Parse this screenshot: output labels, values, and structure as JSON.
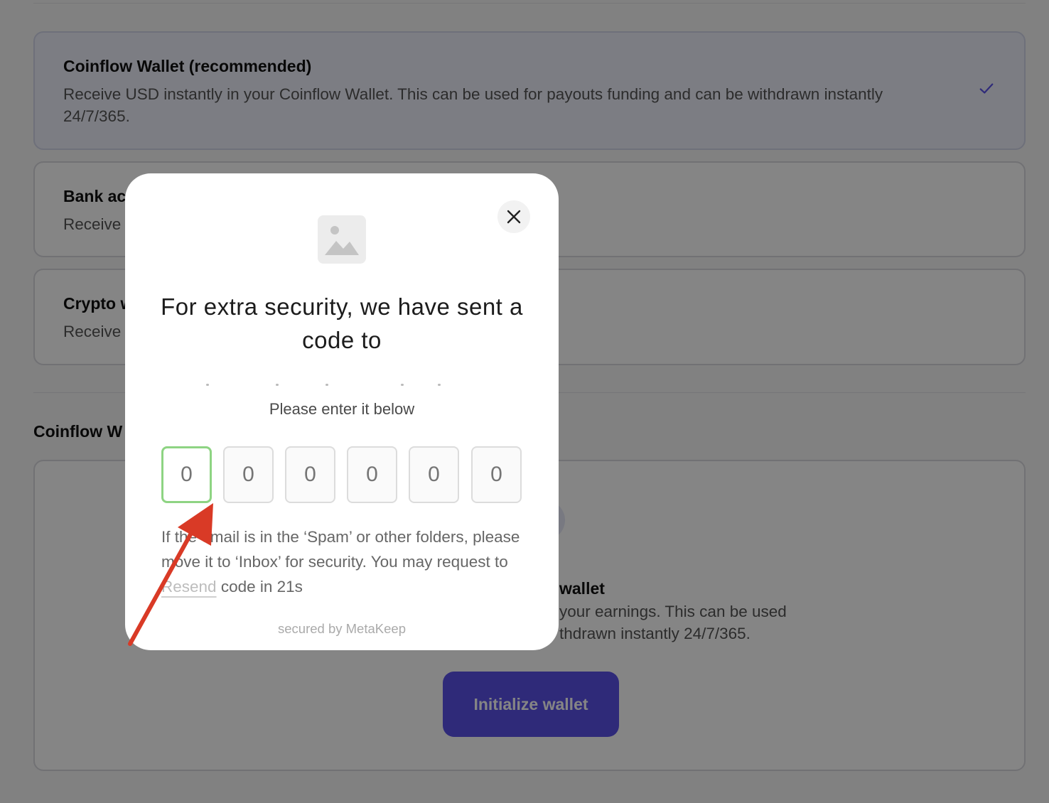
{
  "background": {
    "options": [
      {
        "title": "Coinflow Wallet (recommended)",
        "description": "Receive USD instantly in your Coinflow Wallet. This can be used for payouts funding and can be withdrawn instantly 24/7/365.",
        "selected": true
      },
      {
        "title": "Bank ac",
        "description": "Receive",
        "selected": false
      },
      {
        "title": "Crypto w",
        "description": "Receive",
        "selected": false
      }
    ],
    "section_title": "Coinflow W",
    "panel": {
      "heading": "wallet",
      "description": "your earnings. This can be used\nthdrawn instantly 24/7/365.",
      "button_label": "Initialize wallet"
    }
  },
  "modal": {
    "heading": "For extra security, we have sent a code to",
    "subheading": "Please enter it below",
    "otp_digits": [
      "0",
      "0",
      "0",
      "0",
      "0",
      "0"
    ],
    "help_text_before": "If the email is in the ‘Spam’ or other folders, please move it to ‘Inbox’ for security. You may request to ",
    "resend_label": "Resend",
    "help_text_after": " code in 21s",
    "footer": "secured by MetaKeep"
  },
  "colors": {
    "accent": "#5a52e8",
    "active_input_border": "#8ed483",
    "annotation_arrow": "#d93a26"
  }
}
